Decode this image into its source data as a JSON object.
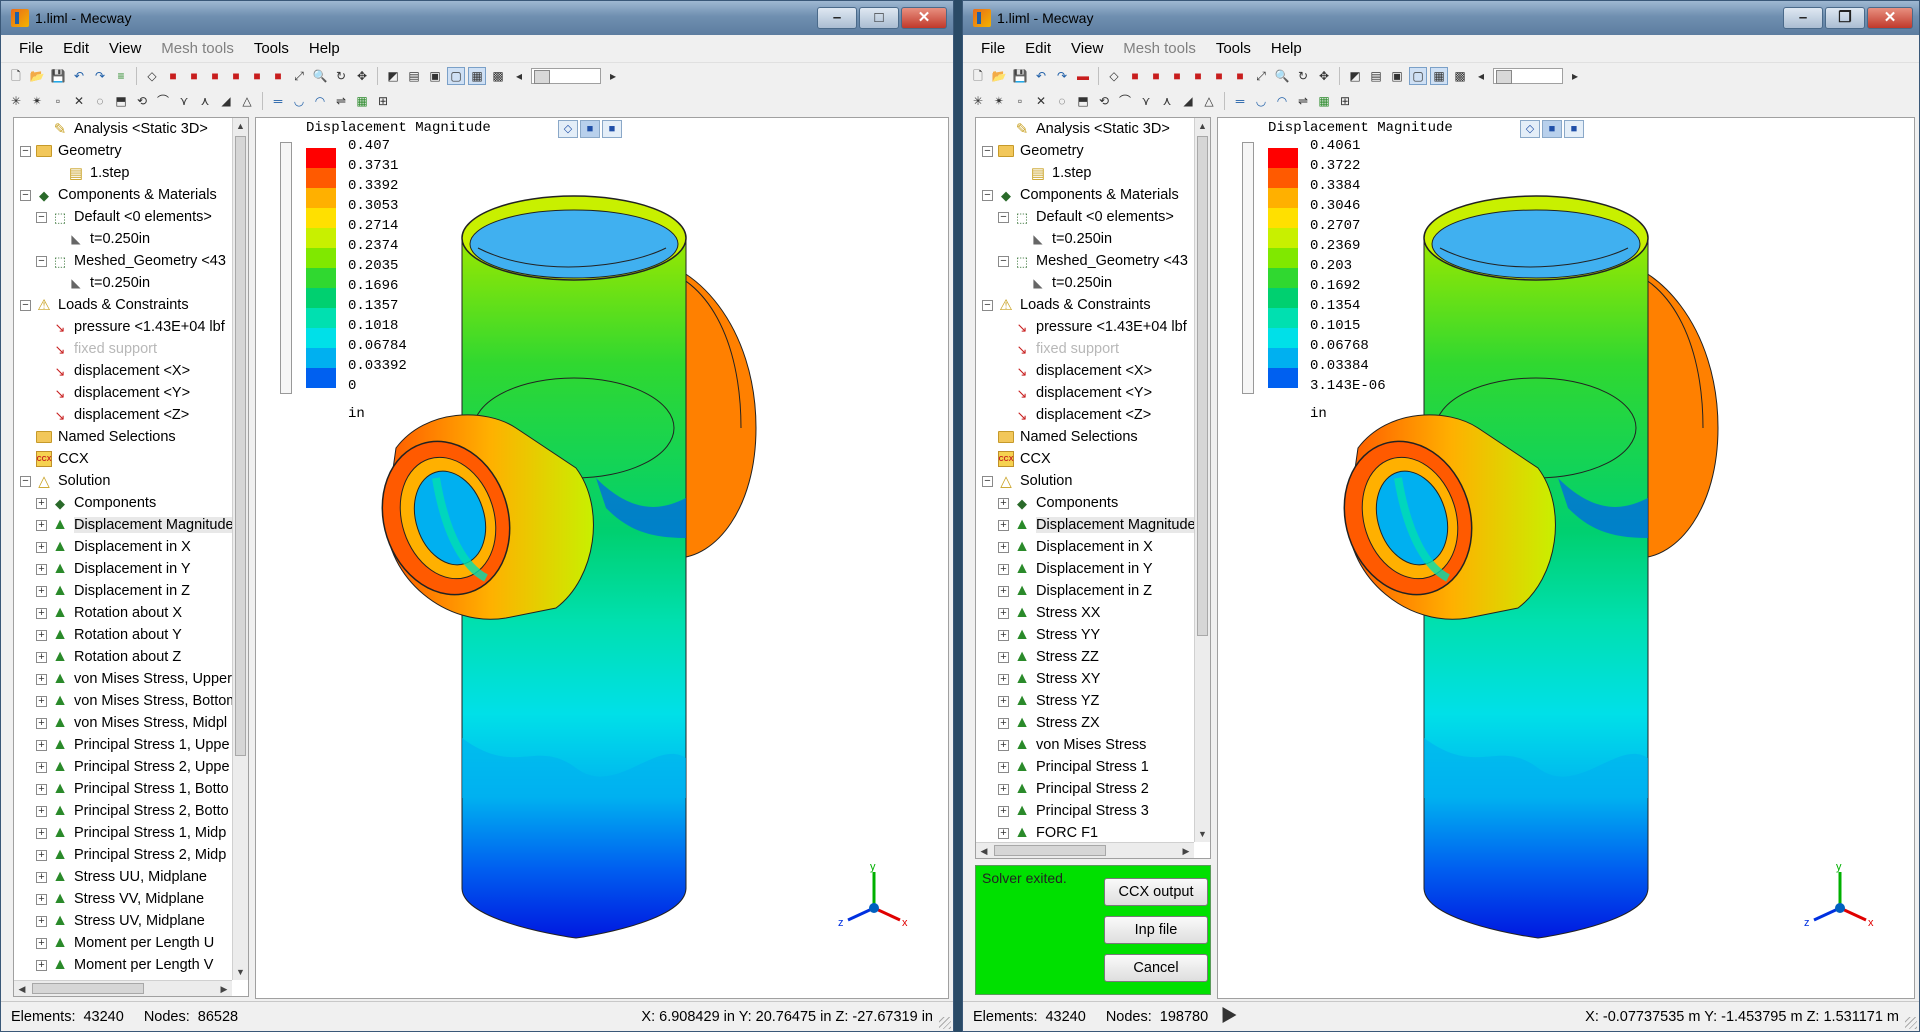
{
  "windows": [
    {
      "title": "1.liml - Mecway",
      "menu": [
        "File",
        "Edit",
        "View",
        "Mesh tools",
        "Tools",
        "Help"
      ],
      "menu_disabled": [
        "Mesh tools"
      ],
      "tree": [
        {
          "label": "Analysis <Static 3D>",
          "level": 1,
          "icon": "analysis-icon",
          "expander": "none"
        },
        {
          "label": "Geometry",
          "level": 0,
          "icon": "folder-icon",
          "expander": "-"
        },
        {
          "label": "1.step",
          "level": 2,
          "icon": "step-file-icon",
          "expander": "none"
        },
        {
          "label": "Components & Materials",
          "level": 0,
          "icon": "components-icon",
          "expander": "-"
        },
        {
          "label": "Default <0 elements>",
          "level": 1,
          "icon": "component-icon",
          "expander": "-"
        },
        {
          "label": "t=0.250in",
          "level": 2,
          "icon": "thickness-icon",
          "expander": "none"
        },
        {
          "label": "Meshed_Geometry <43",
          "level": 1,
          "icon": "component-icon",
          "expander": "-"
        },
        {
          "label": "t=0.250in",
          "level": 2,
          "icon": "thickness-icon",
          "expander": "none"
        },
        {
          "label": "Loads & Constraints",
          "level": 0,
          "icon": "loads-icon",
          "expander": "-"
        },
        {
          "label": "pressure <1.43E+04 lbf",
          "level": 1,
          "icon": "load-icon",
          "expander": "none"
        },
        {
          "label": "fixed support",
          "level": 1,
          "icon": "load-icon",
          "expander": "none",
          "dim": true
        },
        {
          "label": "displacement <X>",
          "level": 1,
          "icon": "load-icon",
          "expander": "none"
        },
        {
          "label": "displacement <Y>",
          "level": 1,
          "icon": "load-icon",
          "expander": "none"
        },
        {
          "label": "displacement <Z>",
          "level": 1,
          "icon": "load-icon",
          "expander": "none"
        },
        {
          "label": "Named Selections",
          "level": 0,
          "icon": "folder-icon",
          "expander": "none"
        },
        {
          "label": "CCX",
          "level": 0,
          "icon": "ccx-icon",
          "expander": "none"
        },
        {
          "label": "Solution",
          "level": 0,
          "icon": "solution-icon",
          "expander": "-"
        },
        {
          "label": "Components",
          "level": 1,
          "icon": "components-icon",
          "expander": "+"
        },
        {
          "label": "Displacement Magnitude",
          "level": 1,
          "icon": "result-icon",
          "expander": "+",
          "selected": true
        },
        {
          "label": "Displacement in X",
          "level": 1,
          "icon": "result-icon",
          "expander": "+"
        },
        {
          "label": "Displacement in Y",
          "level": 1,
          "icon": "result-icon",
          "expander": "+"
        },
        {
          "label": "Displacement in Z",
          "level": 1,
          "icon": "result-icon",
          "expander": "+"
        },
        {
          "label": "Rotation about X",
          "level": 1,
          "icon": "result-icon",
          "expander": "+"
        },
        {
          "label": "Rotation about Y",
          "level": 1,
          "icon": "result-icon",
          "expander": "+"
        },
        {
          "label": "Rotation about Z",
          "level": 1,
          "icon": "result-icon",
          "expander": "+"
        },
        {
          "label": "von Mises Stress, Upper",
          "level": 1,
          "icon": "result-icon",
          "expander": "+"
        },
        {
          "label": "von Mises Stress, Bottom",
          "level": 1,
          "icon": "result-icon",
          "expander": "+"
        },
        {
          "label": "von Mises Stress, Midpl",
          "level": 1,
          "icon": "result-icon",
          "expander": "+"
        },
        {
          "label": "Principal Stress 1, Uppe",
          "level": 1,
          "icon": "result-icon",
          "expander": "+"
        },
        {
          "label": "Principal Stress 2, Uppe",
          "level": 1,
          "icon": "result-icon",
          "expander": "+"
        },
        {
          "label": "Principal Stress 1, Botto",
          "level": 1,
          "icon": "result-icon",
          "expander": "+"
        },
        {
          "label": "Principal Stress 2, Botto",
          "level": 1,
          "icon": "result-icon",
          "expander": "+"
        },
        {
          "label": "Principal Stress 1, Midp",
          "level": 1,
          "icon": "result-icon",
          "expander": "+"
        },
        {
          "label": "Principal Stress 2, Midp",
          "level": 1,
          "icon": "result-icon",
          "expander": "+"
        },
        {
          "label": "Stress UU, Midplane",
          "level": 1,
          "icon": "result-icon",
          "expander": "+"
        },
        {
          "label": "Stress VV, Midplane",
          "level": 1,
          "icon": "result-icon",
          "expander": "+"
        },
        {
          "label": "Stress UV, Midplane",
          "level": 1,
          "icon": "result-icon",
          "expander": "+"
        },
        {
          "label": "Moment per Length U",
          "level": 1,
          "icon": "result-icon",
          "expander": "+"
        },
        {
          "label": "Moment per Length V",
          "level": 1,
          "icon": "result-icon",
          "expander": "+"
        }
      ],
      "legend": {
        "title": "Displacement Magnitude",
        "values": [
          "0.407",
          "0.3731",
          "0.3392",
          "0.3053",
          "0.2714",
          "0.2374",
          "0.2035",
          "0.1696",
          "0.1357",
          "0.1018",
          "0.06784",
          "0.03392",
          "0"
        ],
        "unit": "in"
      },
      "status": {
        "elements_label": "Elements:",
        "elements": "43240",
        "nodes_label": "Nodes:",
        "nodes": "86528",
        "coords": "X: 6.908429 in Y: 20.76475 in Z: -27.67319 in"
      }
    },
    {
      "title": "1.liml - Mecway",
      "menu": [
        "File",
        "Edit",
        "View",
        "Mesh tools",
        "Tools",
        "Help"
      ],
      "menu_disabled": [
        "Mesh tools"
      ],
      "tree": [
        {
          "label": "Analysis <Static 3D>",
          "level": 1,
          "icon": "analysis-icon",
          "expander": "none"
        },
        {
          "label": "Geometry",
          "level": 0,
          "icon": "folder-icon",
          "expander": "-"
        },
        {
          "label": "1.step",
          "level": 2,
          "icon": "step-file-icon",
          "expander": "none"
        },
        {
          "label": "Components & Materials",
          "level": 0,
          "icon": "components-icon",
          "expander": "-"
        },
        {
          "label": "Default <0 elements>",
          "level": 1,
          "icon": "component-icon",
          "expander": "-"
        },
        {
          "label": "t=0.250in",
          "level": 2,
          "icon": "thickness-icon",
          "expander": "none"
        },
        {
          "label": "Meshed_Geometry <43",
          "level": 1,
          "icon": "component-icon",
          "expander": "-"
        },
        {
          "label": "t=0.250in",
          "level": 2,
          "icon": "thickness-icon",
          "expander": "none"
        },
        {
          "label": "Loads & Constraints",
          "level": 0,
          "icon": "loads-icon",
          "expander": "-"
        },
        {
          "label": "pressure <1.43E+04 lbf",
          "level": 1,
          "icon": "load-icon",
          "expander": "none"
        },
        {
          "label": "fixed support",
          "level": 1,
          "icon": "load-icon",
          "expander": "none",
          "dim": true
        },
        {
          "label": "displacement <X>",
          "level": 1,
          "icon": "load-icon",
          "expander": "none"
        },
        {
          "label": "displacement <Y>",
          "level": 1,
          "icon": "load-icon",
          "expander": "none"
        },
        {
          "label": "displacement <Z>",
          "level": 1,
          "icon": "load-icon",
          "expander": "none"
        },
        {
          "label": "Named Selections",
          "level": 0,
          "icon": "folder-icon",
          "expander": "none"
        },
        {
          "label": "CCX",
          "level": 0,
          "icon": "ccx-icon",
          "expander": "none"
        },
        {
          "label": "Solution",
          "level": 0,
          "icon": "solution-icon",
          "expander": "-"
        },
        {
          "label": "Components",
          "level": 1,
          "icon": "components-icon",
          "expander": "+"
        },
        {
          "label": "Displacement Magnitude",
          "level": 1,
          "icon": "result-icon",
          "expander": "+",
          "selected": true
        },
        {
          "label": "Displacement in X",
          "level": 1,
          "icon": "result-icon",
          "expander": "+"
        },
        {
          "label": "Displacement in Y",
          "level": 1,
          "icon": "result-icon",
          "expander": "+"
        },
        {
          "label": "Displacement in Z",
          "level": 1,
          "icon": "result-icon",
          "expander": "+"
        },
        {
          "label": "Stress XX",
          "level": 1,
          "icon": "result-icon",
          "expander": "+"
        },
        {
          "label": "Stress YY",
          "level": 1,
          "icon": "result-icon",
          "expander": "+"
        },
        {
          "label": "Stress ZZ",
          "level": 1,
          "icon": "result-icon",
          "expander": "+"
        },
        {
          "label": "Stress XY",
          "level": 1,
          "icon": "result-icon",
          "expander": "+"
        },
        {
          "label": "Stress YZ",
          "level": 1,
          "icon": "result-icon",
          "expander": "+"
        },
        {
          "label": "Stress ZX",
          "level": 1,
          "icon": "result-icon",
          "expander": "+"
        },
        {
          "label": "von Mises Stress",
          "level": 1,
          "icon": "result-icon",
          "expander": "+"
        },
        {
          "label": "Principal Stress 1",
          "level": 1,
          "icon": "result-icon",
          "expander": "+"
        },
        {
          "label": "Principal Stress 2",
          "level": 1,
          "icon": "result-icon",
          "expander": "+"
        },
        {
          "label": "Principal Stress 3",
          "level": 1,
          "icon": "result-icon",
          "expander": "+"
        },
        {
          "label": "FORC F1",
          "level": 1,
          "icon": "result-icon",
          "expander": "+"
        }
      ],
      "legend": {
        "title": "Displacement Magnitude",
        "values": [
          "0.4061",
          "0.3722",
          "0.3384",
          "0.3046",
          "0.2707",
          "0.2369",
          "0.203",
          "0.1692",
          "0.1354",
          "0.1015",
          "0.06768",
          "0.03384",
          "3.143E-06"
        ],
        "unit": "in"
      },
      "solver": {
        "message": "Solver exited.",
        "buttons": [
          "CCX output",
          "Inp file",
          "Cancel"
        ]
      },
      "status": {
        "elements_label": "Elements:",
        "elements": "43240",
        "nodes_label": "Nodes:",
        "nodes": "198780",
        "coords": "X: -0.07737535 m Y: -1.453795 m Z: 1.531171 m"
      }
    }
  ],
  "legend_colors": [
    "#ff0000",
    "#ff5a00",
    "#ffb000",
    "#ffe000",
    "#c8f000",
    "#80e800",
    "#30d830",
    "#00d070",
    "#00e0b0",
    "#00e0e8",
    "#00b0f0",
    "#0060f0",
    "#0018e0"
  ],
  "triad": {
    "x": "x",
    "y": "y",
    "z": "z"
  }
}
